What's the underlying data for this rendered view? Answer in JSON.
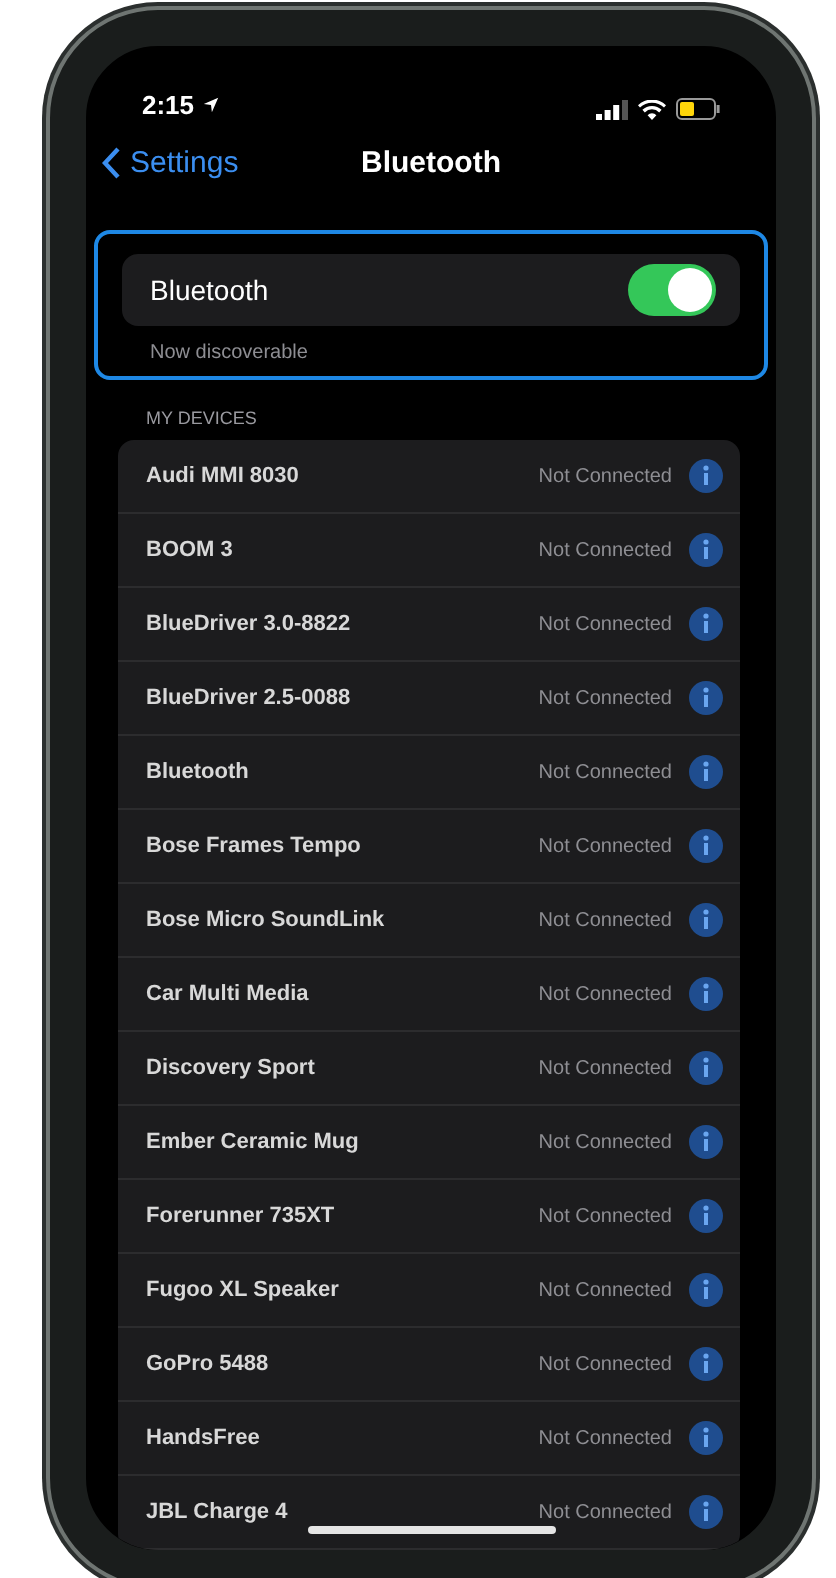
{
  "status_bar": {
    "time": "2:15"
  },
  "nav": {
    "back": "Settings",
    "title": "Bluetooth"
  },
  "bluetooth": {
    "label": "Bluetooth",
    "on": true,
    "highlighted": true,
    "footnote": "Now discoverable"
  },
  "section_header": "MY DEVICES",
  "devices": [
    {
      "name": "Audi MMI 8030",
      "status": "Not Connected"
    },
    {
      "name": "BOOM 3",
      "status": "Not Connected"
    },
    {
      "name": "BlueDriver 3.0-8822",
      "status": "Not Connected"
    },
    {
      "name": "BlueDriver 2.5-0088",
      "status": "Not Connected"
    },
    {
      "name": "Bluetooth",
      "status": "Not Connected"
    },
    {
      "name": "Bose Frames Tempo",
      "status": "Not Connected"
    },
    {
      "name": "Bose Micro SoundLink",
      "status": "Not Connected"
    },
    {
      "name": "Car Multi Media",
      "status": "Not Connected"
    },
    {
      "name": "Discovery Sport",
      "status": "Not Connected"
    },
    {
      "name": "Ember Ceramic Mug",
      "status": "Not Connected"
    },
    {
      "name": "Forerunner 735XT",
      "status": "Not Connected"
    },
    {
      "name": "Fugoo XL Speaker",
      "status": "Not Connected"
    },
    {
      "name": "GoPro 5488",
      "status": "Not Connected"
    },
    {
      "name": "HandsFree",
      "status": "Not Connected"
    },
    {
      "name": "JBL Charge 4",
      "status": "Not Connected"
    }
  ]
}
